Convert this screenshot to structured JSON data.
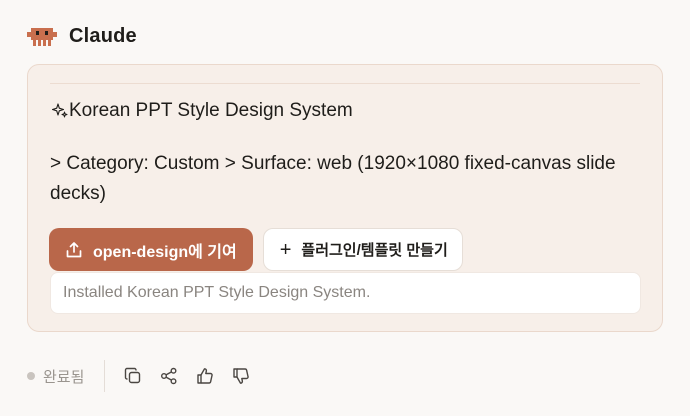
{
  "header": {
    "brand": "Claude",
    "logo_icon": "pixel-creature-icon",
    "logo_color": "#c96f4e"
  },
  "card": {
    "title": "Korean PPT Style Design System",
    "title_icon": "sparkle-icon",
    "description": "> Category: Custom > Surface: web (1920×1080 fixed-canvas slide decks)",
    "primary_button": {
      "label": "open-design에 기여",
      "icon": "upload-icon"
    },
    "secondary_button": {
      "label": "플러그인/템플릿 만들기",
      "icon": "plus-icon"
    },
    "status": "Installed Korean PPT Style Design System."
  },
  "footer": {
    "status": "완료됨",
    "actions": [
      {
        "name": "copy",
        "icon": "copy-icon"
      },
      {
        "name": "share",
        "icon": "share-icon"
      },
      {
        "name": "thumbs-up",
        "icon": "thumbs-up-icon"
      },
      {
        "name": "thumbs-down",
        "icon": "thumbs-down-icon"
      }
    ]
  },
  "colors": {
    "accent": "#b9674a",
    "card_bg": "#f7efe9",
    "page_bg": "#faf8f6"
  }
}
